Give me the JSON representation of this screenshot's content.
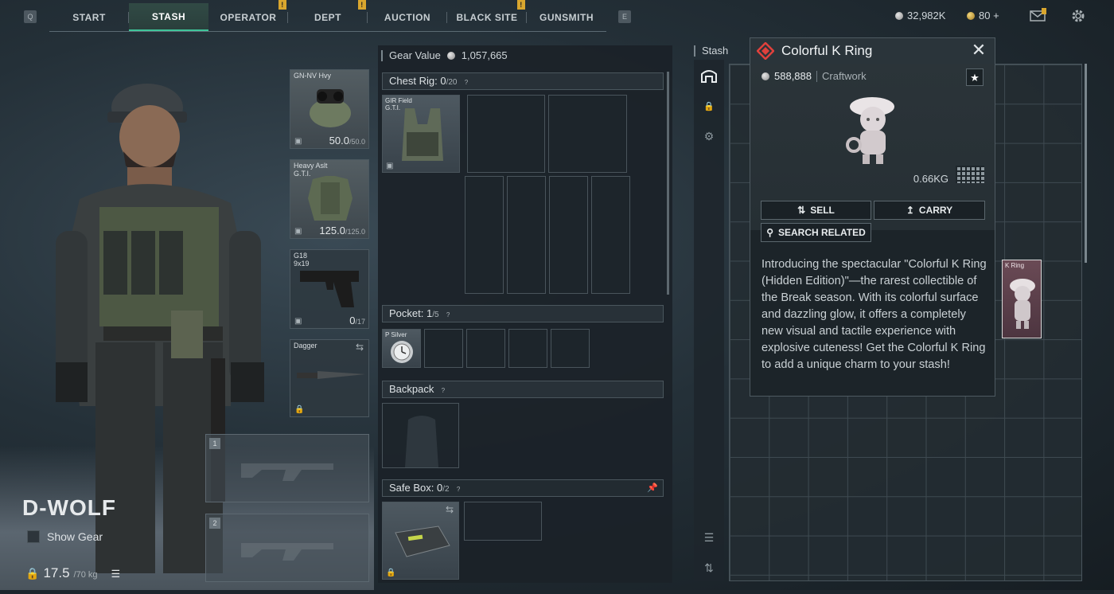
{
  "nav": {
    "left_key": "Q",
    "right_key": "E",
    "tabs": [
      {
        "label": "START",
        "active": false,
        "alert": false
      },
      {
        "label": "STASH",
        "active": true,
        "alert": false
      },
      {
        "label": "OPERATOR",
        "active": false,
        "alert": true
      },
      {
        "label": "DEPT",
        "active": false,
        "alert": true
      },
      {
        "label": "AUCTION",
        "active": false,
        "alert": false
      },
      {
        "label": "BLACK SITE",
        "active": false,
        "alert": true
      },
      {
        "label": "GUNSMITH",
        "active": false,
        "alert": false
      }
    ],
    "alert_mark": "!"
  },
  "currency": {
    "silver": "32,982K",
    "gold": "80 +"
  },
  "operator": {
    "name": "D-WOLF",
    "show_gear_label": "Show Gear",
    "weight": "17.5",
    "weight_max": "/70 kg"
  },
  "equip": {
    "helmet": {
      "label": "GN-NV Hvy",
      "value": "50.0",
      "max": "/50.0"
    },
    "armor": {
      "label": "Heavy Aslt\nG.T.I.",
      "value": "125.0",
      "max": "/125.0"
    },
    "sidearm": {
      "label": "G18\n9x19",
      "value": "0",
      "max": "/17"
    },
    "melee": {
      "label": "Dagger"
    },
    "weapon1": "1",
    "weapon2": "2"
  },
  "gear": {
    "title": "Gear Value",
    "value": "1,057,665",
    "chest_rig": {
      "label": "Chest Rig:",
      "count": "0",
      "max": "/20",
      "item": "GIR Field\nG.T.I."
    },
    "pocket": {
      "label": "Pocket:",
      "count": "1",
      "max": "/5",
      "item": "P Silver"
    },
    "backpack": {
      "label": "Backpack"
    },
    "safe_box": {
      "label": "Safe Box:",
      "count": "0",
      "max": "/2"
    },
    "help": "?"
  },
  "stash": {
    "label": "Stash",
    "item_label": "K Ring"
  },
  "popup": {
    "title": "Colorful K Ring",
    "price": "588,888",
    "category": "Craftwork",
    "weight": "0.66KG",
    "sell": "SELL",
    "carry": "CARRY",
    "search": "SEARCH RELATED",
    "description": "Introducing the spectacular \"Colorful K Ring (Hidden Edition)\"—the rarest collectible of the Break season. With its colorful surface and dazzling glow, it offers a completely new visual and tactile experience with explosive cuteness! Get the Colorful K Ring to add a unique charm to your stash!"
  },
  "colors": {
    "accent": "#3fc59a",
    "alert": "#d9a62e",
    "rarity": "#e0413c"
  }
}
